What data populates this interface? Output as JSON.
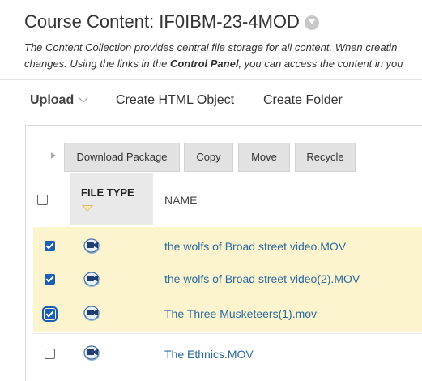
{
  "page": {
    "title": "Course Content: IF0IBM-23-4MOD",
    "description_line1_start": "The Content Collection provides central file storage for all content. When creatin",
    "description_line2_start": "changes. Using the links in the ",
    "description_line2_bold": "Control Panel",
    "description_line2_end": ", you can access the content in you"
  },
  "toolbar": {
    "upload_label": "Upload",
    "create_html_label": "Create HTML Object",
    "create_folder_label": "Create Folder"
  },
  "actions": {
    "download_label": "Download Package",
    "copy_label": "Copy",
    "move_label": "Move",
    "recycle_label": "Recycle"
  },
  "table": {
    "columns": [
      "FILE TYPE",
      "NAME"
    ],
    "rows": [
      {
        "name": "the wolfs of Broad street video.MOV",
        "checked": true,
        "icon": "video-file-icon"
      },
      {
        "name": "the wolfs of Broad street video(2).MOV",
        "checked": true,
        "icon": "video-file-icon"
      },
      {
        "name": "The Three Musketeers(1).mov",
        "checked": true,
        "icon": "video-file-icon"
      },
      {
        "name": "The Ethnics.MOV",
        "checked": false,
        "icon": "video-file-icon"
      }
    ]
  },
  "colors": {
    "selected_row": "#fbf4cf",
    "link": "#2d6a9f",
    "button_bg": "#e2e2e2",
    "header_cell": "#e9e9e9"
  }
}
